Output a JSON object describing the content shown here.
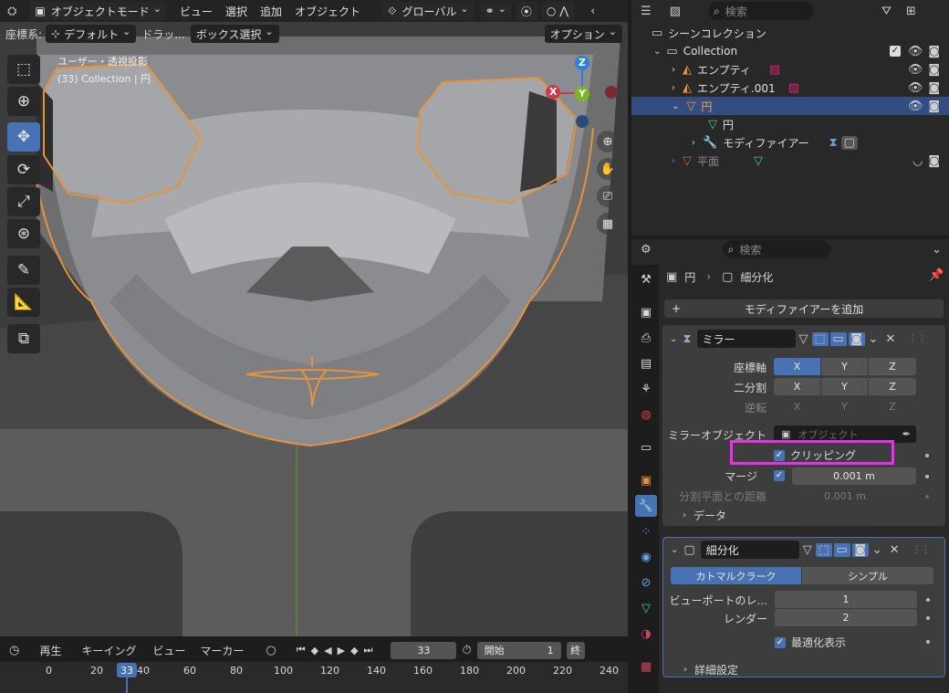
{
  "viewport": {
    "header": {
      "mode": "オブジェクトモード",
      "menus": [
        "ビュー",
        "選択",
        "追加",
        "オブジェクト"
      ],
      "transform_orientation": "グローバル"
    },
    "sub": {
      "coord_label": "座標系:",
      "coord_value": "デフォルト",
      "drag_label": "ドラッ...",
      "drag_value": "ボックス選択",
      "options": "オプション"
    },
    "overlay_text": {
      "line1": "ユーザー・透視投影",
      "line2": "(33) Collection | 円"
    },
    "gizmo": {
      "x": "X",
      "y": "Y",
      "z": "Z"
    }
  },
  "timeline": {
    "menus": [
      "再生",
      "キーイング",
      "ビュー",
      "マーカー"
    ],
    "current_frame": "33",
    "start_label": "開始",
    "start_value": "1",
    "end_label": "終",
    "ruler": [
      "0",
      "20",
      "40",
      "60",
      "80",
      "100",
      "120",
      "140",
      "160",
      "180",
      "200",
      "220",
      "240"
    ]
  },
  "outliner": {
    "search_placeholder": "検索",
    "scene_collection": "シーンコレクション",
    "collection": "Collection",
    "items": [
      {
        "name": "エンプティ"
      },
      {
        "name": "エンプティ.001"
      },
      {
        "name": "円"
      },
      {
        "name": "円"
      },
      {
        "name": "モディファイアー"
      },
      {
        "name": "平面"
      }
    ]
  },
  "properties": {
    "search_placeholder": "検索",
    "breadcrumb": {
      "object": "円",
      "modifier": "細分化"
    },
    "add_modifier": "モディファイアーを追加",
    "mirror": {
      "name": "ミラー",
      "axis_label": "座標軸",
      "bisect_label": "二分割",
      "flip_label": "逆転",
      "axes": [
        "X",
        "Y",
        "Z"
      ],
      "mirror_object_label": "ミラーオブジェクト",
      "mirror_object_placeholder": "オブジェクト",
      "clipping_label": "クリッピング",
      "merge_label": "マージ",
      "merge_value": "0.001 m",
      "bisect_distance_label": "分割平面との距離",
      "bisect_distance_value": "0.001 m",
      "data_label": "データ"
    },
    "subsurf": {
      "name": "細分化",
      "mode_catmull": "カトマルクラーク",
      "mode_simple": "シンプル",
      "viewport_label": "ビューポートのレ...",
      "viewport_value": "1",
      "render_label": "レンダー",
      "render_value": "2",
      "optimal_label": "最適化表示",
      "advanced_label": "詳細設定"
    }
  },
  "colors": {
    "accent": "#4772b3",
    "selection_outline": "#e8923a",
    "highlight_box": "#e830e8",
    "axis_x": "#c83b4b",
    "axis_y": "#7ab81f",
    "axis_z": "#2f7fd6"
  }
}
